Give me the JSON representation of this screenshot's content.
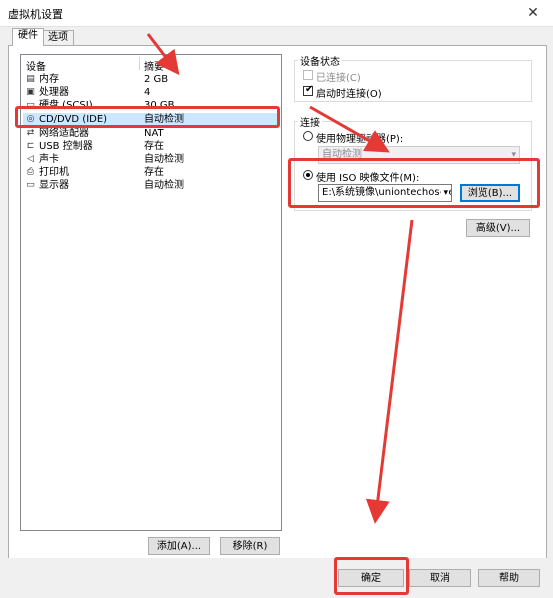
{
  "window": {
    "title": "虚拟机设置",
    "close": "✕"
  },
  "tabs": [
    {
      "label": "硬件"
    },
    {
      "label": "选项"
    }
  ],
  "device_list": {
    "headers": {
      "device": "设备",
      "summary": "摘要"
    },
    "rows": [
      {
        "icon": "memory-icon",
        "glyph": "▤",
        "name": "内存",
        "summary": "2 GB"
      },
      {
        "icon": "cpu-icon",
        "glyph": "▣",
        "name": "处理器",
        "summary": "4"
      },
      {
        "icon": "disk-icon",
        "glyph": "▭",
        "name": "硬盘 (SCSI)",
        "summary": "30 GB"
      },
      {
        "icon": "cd-icon",
        "glyph": "◎",
        "name": "CD/DVD (IDE)",
        "summary": "自动检测"
      },
      {
        "icon": "network-icon",
        "glyph": "⇄",
        "name": "网络适配器",
        "summary": "NAT"
      },
      {
        "icon": "usb-icon",
        "glyph": "⊏",
        "name": "USB 控制器",
        "summary": "存在"
      },
      {
        "icon": "sound-icon",
        "glyph": "◁",
        "name": "声卡",
        "summary": "自动检测"
      },
      {
        "icon": "printer-icon",
        "glyph": "⎙",
        "name": "打印机",
        "summary": "存在"
      },
      {
        "icon": "display-icon",
        "glyph": "▭",
        "name": "显示器",
        "summary": "自动检测"
      }
    ]
  },
  "device_status": {
    "title": "设备状态",
    "connected_label": "已连接(C)",
    "connected_checked": false,
    "connect_on_power_on_label": "启动时连接(O)",
    "connect_on_power_on_checked": true,
    "check_mark": "✔"
  },
  "connection": {
    "title": "连接",
    "physical_drive_label": "使用物理驱动器(P):",
    "physical_drive_value": "自动检测",
    "iso_label": "使用 ISO 映像文件(M):",
    "iso_path": "E:\\系统镜像\\uniontechos-se",
    "browse_label": "浏览(B)...",
    "advanced_label": "高级(V)..."
  },
  "list_buttons": {
    "add": "添加(A)...",
    "remove": "移除(R)"
  },
  "footer": {
    "ok": "确定",
    "cancel": "取消",
    "help": "帮助"
  },
  "annotation_color": "#e53935"
}
